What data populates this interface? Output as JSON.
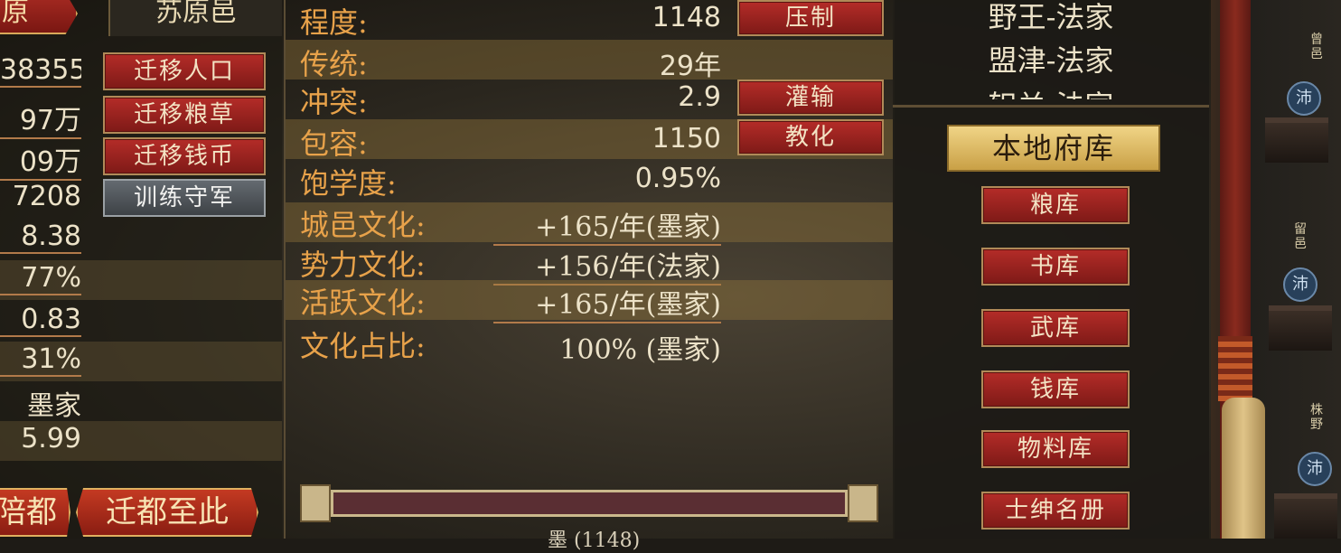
{
  "left": {
    "tab_label": "原",
    "city_name": "苏原邑",
    "rows": [
      {
        "value": "38355",
        "button": "迁移人口"
      },
      {
        "value": "97万",
        "button": "迁移粮草"
      },
      {
        "value": "09万",
        "button": "迁移钱币"
      },
      {
        "value": "7208",
        "button": "训练守军"
      },
      {
        "value": "8.38"
      },
      {
        "value": "77%"
      },
      {
        "value": "0.83"
      },
      {
        "value": "31%"
      },
      {
        "value": "墨家"
      },
      {
        "value": "5.99"
      }
    ],
    "bottom_left_label": "陪都",
    "bottom_right_label": "迁都至此"
  },
  "mid": {
    "rows": [
      {
        "label": "程度:",
        "value": "1148",
        "button": "压制"
      },
      {
        "label": "传统:",
        "value": "29年"
      },
      {
        "label": "冲突:",
        "value": "2.9",
        "button": "灌输"
      },
      {
        "label": "包容:",
        "value": "1150",
        "button": "教化"
      },
      {
        "label": "饱学度:",
        "value": "0.95%"
      }
    ],
    "culture_rows": [
      {
        "label": "城邑文化:",
        "value": "+165/年(墨家)"
      },
      {
        "label": "势力文化:",
        "value": "+156/年(法家)"
      },
      {
        "label": "活跃文化:",
        "value": "+165/年(墨家)"
      },
      {
        "label": "文化占比:",
        "value": "100% (墨家)"
      }
    ],
    "bar_label": "墨 (1148)"
  },
  "right": {
    "list": [
      "野王-法家",
      "盟津-法家",
      "轵关-法家"
    ],
    "active_tab": "本地府库",
    "stores": [
      "粮库",
      "书库",
      "武库",
      "钱库",
      "物料库",
      "士绅名册"
    ]
  },
  "map": {
    "cities": [
      "曾邑",
      "留邑",
      "株野"
    ],
    "markers": [
      "沛",
      "沛",
      "沛"
    ]
  },
  "colors": {
    "label_orange": "#e8a24a",
    "value_cream": "#ece2c8",
    "button_red": "#b42c28",
    "button_gray": "#646a70",
    "tab_gold": "#f0d486"
  }
}
